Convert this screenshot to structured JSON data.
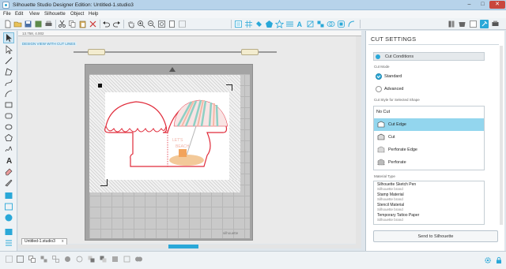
{
  "window": {
    "title": "Silhouette Studio Designer Edition: Untitled-1.studio3",
    "min": "–",
    "max": "□",
    "close": "✕"
  },
  "menu": [
    "File",
    "Edit",
    "View",
    "Silhouette",
    "Object",
    "Help"
  ],
  "canvas": {
    "coords": "13.758, 4.002",
    "design_label": "DESIGN VIEW WITH CUT LINES",
    "brand": "silhouette",
    "doc_tab": "Untitled-1.studio3",
    "doc_tab_close": "x"
  },
  "panel": {
    "title": "CUT SETTINGS",
    "section": "Cut Conditions",
    "cut_mode_label": "Cut Mode",
    "modes": [
      {
        "label": "Standard",
        "checked": true
      },
      {
        "label": "Advanced",
        "checked": false
      }
    ],
    "cut_style_label": "Cut Style for Selected Shape",
    "no_cut": "No Cut",
    "styles": [
      {
        "label": "Cut Edge",
        "selected": true
      },
      {
        "label": "Cut",
        "selected": false
      },
      {
        "label": "Perforate Edge",
        "selected": false
      },
      {
        "label": "Perforate",
        "selected": false
      }
    ],
    "material_type_label": "Material Type",
    "materials": [
      {
        "name": "Silhouette Sketch Pen",
        "brand": "Silhouette brand"
      },
      {
        "name": "Stamp Material",
        "brand": "Silhouette brand"
      },
      {
        "name": "Stencil Material",
        "brand": "Silhouette brand"
      },
      {
        "name": "Temporary Tattoo Paper",
        "brand": "Silhouette brand"
      }
    ],
    "send_button": "Send to Silhouette"
  },
  "colors": {
    "accent": "#2aa8d8",
    "cut_line": "#e02b3a",
    "selected_row": "#93d6ee"
  },
  "icons": [
    "cut-settings-icon",
    "design-icon",
    "settings-gear-icon",
    "lock-icon"
  ]
}
